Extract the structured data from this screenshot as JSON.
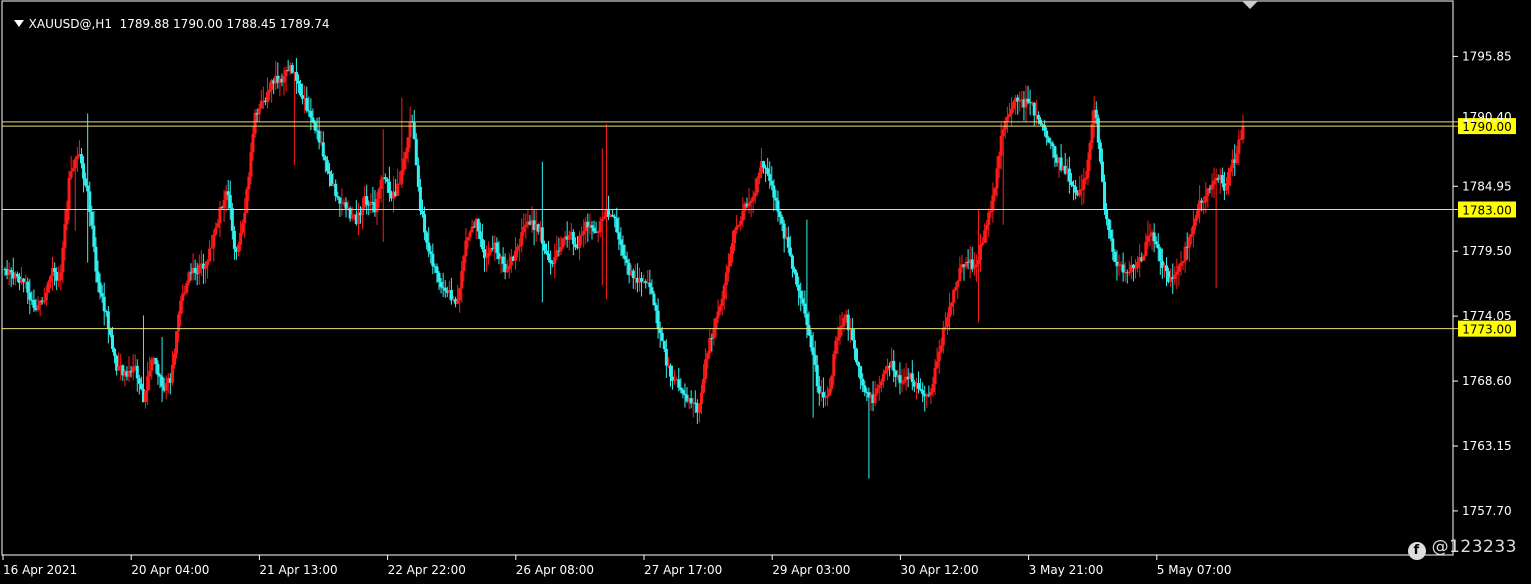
{
  "header": {
    "symbol": "XAUUSD@,H1",
    "ohlc": "1789.88 1790.00 1788.45 1789.74"
  },
  "colors": {
    "background": "#000000",
    "bull": "#ff1a1a",
    "bear": "#33f0f0",
    "level_line": "#e6e07a",
    "level_tag_bg": "#ffff00",
    "frame": "#ffffff"
  },
  "watermark": {
    "text": "@123233",
    "icon": "circle-logo-icon"
  },
  "chart_data": {
    "type": "candlestick",
    "timeframe": "H1",
    "ylim": [
      1754.0,
      1800.5
    ],
    "y_ticks": [
      "1795.85",
      "1784.95",
      "1779.50",
      "1774.05",
      "1768.60",
      "1763.15",
      "1757.70"
    ],
    "x_ticks": [
      "16 Apr 2021",
      "20 Apr 04:00",
      "21 Apr 13:00",
      "22 Apr 22:00",
      "26 Apr 08:00",
      "27 Apr 17:00",
      "29 Apr 03:00",
      "30 Apr 12:00",
      "3 May 21:00",
      "5 May 07:00"
    ],
    "horizontal_levels": [
      {
        "value": 1790.0,
        "label": "1790.00"
      },
      {
        "value": 1783.0,
        "label": "1783.00"
      },
      {
        "value": 1773.0,
        "label": "1773.00"
      }
    ],
    "extra_level": {
      "value": 1790.35
    },
    "path_points": [
      [
        0,
        1778
      ],
      [
        2,
        1777
      ],
      [
        3,
        1775
      ],
      [
        4,
        1775
      ],
      [
        5,
        1778
      ],
      [
        6,
        1777
      ],
      [
        7,
        1786
      ],
      [
        8,
        1788
      ],
      [
        9,
        1784
      ],
      [
        10,
        1777
      ],
      [
        11,
        1774
      ],
      [
        12,
        1770
      ],
      [
        13,
        1769
      ],
      [
        14,
        1770
      ],
      [
        15,
        1767
      ],
      [
        16,
        1771
      ],
      [
        17,
        1768
      ],
      [
        18,
        1769
      ],
      [
        19,
        1775
      ],
      [
        20,
        1778
      ],
      [
        21,
        1778
      ],
      [
        22,
        1779
      ],
      [
        23,
        1782
      ],
      [
        24,
        1785
      ],
      [
        25,
        1779
      ],
      [
        26,
        1783
      ],
      [
        27,
        1791
      ],
      [
        28,
        1792
      ],
      [
        29,
        1794
      ],
      [
        30,
        1794
      ],
      [
        31,
        1795
      ],
      [
        32,
        1793
      ],
      [
        33,
        1791
      ],
      [
        34,
        1789
      ],
      [
        35,
        1786
      ],
      [
        36,
        1784
      ],
      [
        37,
        1783
      ],
      [
        38,
        1782
      ],
      [
        39,
        1784
      ],
      [
        40,
        1783
      ],
      [
        41,
        1786
      ],
      [
        42,
        1784
      ],
      [
        43,
        1786
      ],
      [
        44,
        1791
      ],
      [
        45,
        1783
      ],
      [
        46,
        1779
      ],
      [
        47,
        1777
      ],
      [
        48,
        1776
      ],
      [
        49,
        1775
      ],
      [
        50,
        1781
      ],
      [
        51,
        1782
      ],
      [
        52,
        1779
      ],
      [
        53,
        1780
      ],
      [
        54,
        1778
      ],
      [
        55,
        1779
      ],
      [
        56,
        1781
      ],
      [
        57,
        1782
      ],
      [
        58,
        1781
      ],
      [
        59,
        1778
      ],
      [
        60,
        1780
      ],
      [
        61,
        1781
      ],
      [
        62,
        1780
      ],
      [
        63,
        1782
      ],
      [
        64,
        1781
      ],
      [
        65,
        1783
      ],
      [
        66,
        1782
      ],
      [
        67,
        1779
      ],
      [
        68,
        1777
      ],
      [
        69,
        1777
      ],
      [
        70,
        1776
      ],
      [
        71,
        1772
      ],
      [
        72,
        1769
      ],
      [
        73,
        1768
      ],
      [
        74,
        1767
      ],
      [
        75,
        1766
      ],
      [
        76,
        1771
      ],
      [
        77,
        1774
      ],
      [
        78,
        1777
      ],
      [
        79,
        1781
      ],
      [
        80,
        1783
      ],
      [
        81,
        1784
      ],
      [
        82,
        1787
      ],
      [
        83,
        1785
      ],
      [
        84,
        1782
      ],
      [
        85,
        1779
      ],
      [
        86,
        1776
      ],
      [
        87,
        1773
      ],
      [
        88,
        1768
      ],
      [
        89,
        1767
      ],
      [
        90,
        1772
      ],
      [
        91,
        1774
      ],
      [
        92,
        1771
      ],
      [
        93,
        1768
      ],
      [
        94,
        1767
      ],
      [
        95,
        1769
      ],
      [
        96,
        1770
      ],
      [
        97,
        1768
      ],
      [
        98,
        1769
      ],
      [
        99,
        1768
      ],
      [
        100,
        1767
      ],
      [
        101,
        1771
      ],
      [
        102,
        1774
      ],
      [
        103,
        1777
      ],
      [
        104,
        1779
      ],
      [
        105,
        1778
      ],
      [
        106,
        1781
      ],
      [
        107,
        1784
      ],
      [
        108,
        1790
      ],
      [
        109,
        1792
      ],
      [
        110,
        1792
      ],
      [
        111,
        1792
      ],
      [
        112,
        1790
      ],
      [
        113,
        1789
      ],
      [
        114,
        1787
      ],
      [
        115,
        1786
      ],
      [
        116,
        1784
      ],
      [
        117,
        1786
      ],
      [
        118,
        1792
      ],
      [
        119,
        1783
      ],
      [
        120,
        1779
      ],
      [
        121,
        1778
      ],
      [
        122,
        1778
      ],
      [
        123,
        1779
      ],
      [
        124,
        1781
      ],
      [
        125,
        1779
      ],
      [
        126,
        1777
      ],
      [
        127,
        1778
      ],
      [
        128,
        1780
      ],
      [
        129,
        1783
      ],
      [
        130,
        1784
      ],
      [
        131,
        1786
      ],
      [
        132,
        1785
      ],
      [
        133,
        1787
      ],
      [
        134,
        1789.74
      ]
    ]
  }
}
